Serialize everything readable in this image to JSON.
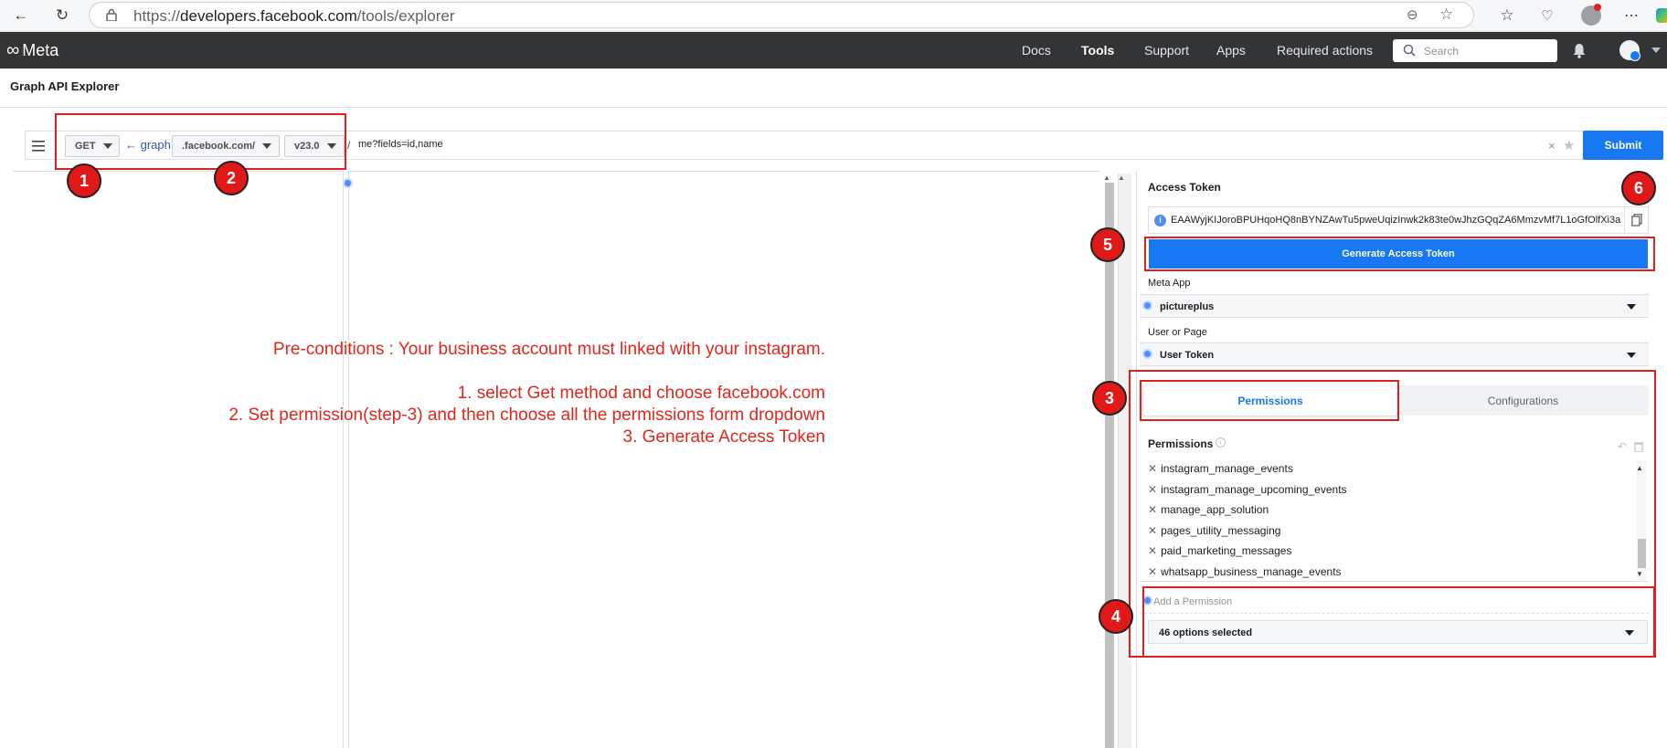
{
  "browser": {
    "url_prefix": "https://",
    "url_host": "developers.facebook.com",
    "url_path": "/tools/explorer"
  },
  "nav": {
    "logo": "Meta",
    "links": [
      "Docs",
      "Tools",
      "Support",
      "Apps",
      "Required actions"
    ],
    "active": "Tools",
    "search_placeholder": "Search"
  },
  "page": {
    "title": "Graph API Explorer"
  },
  "query": {
    "method": "GET",
    "host_prefix": "← graph.",
    "domain": ".facebook.com/",
    "version": "v23.0",
    "slash": "/",
    "path": "me?fields=id,name",
    "submit_label": "Submit"
  },
  "token": {
    "section_label": "Access Token",
    "value": "EAAWyjKIJoroBPUHqoHQ8nBYNZAwTu5pweUqizInwk2k83te0wJhzGQqZA6MmzvMf7L1oGfOlfXi3a",
    "generate_label": "Generate Access Token"
  },
  "meta_app": {
    "label": "Meta App",
    "value": "pictureplus"
  },
  "user_page": {
    "label": "User or Page",
    "value": "User Token"
  },
  "tabs": {
    "permissions": "Permissions",
    "configurations": "Configurations"
  },
  "permissions": {
    "heading": "Permissions",
    "items": [
      "instagram_manage_events",
      "instagram_manage_upcoming_events",
      "manage_app_solution",
      "pages_utility_messaging",
      "paid_marketing_messages",
      "whatsapp_business_manage_events"
    ],
    "add_placeholder": "Add a Permission",
    "selected_summary": "46 options selected"
  },
  "annotations": {
    "line1": "Pre-conditions : Your business account must linked with your instagram.",
    "line2": "1. select Get method and choose facebook.com",
    "line3": "2. Set permission(step-3) and then choose all the permissions form dropdown",
    "line4": "3. Generate Access Token",
    "badges": [
      "1",
      "2",
      "3",
      "4",
      "5",
      "6"
    ]
  },
  "colors": {
    "brand_blue": "#1877f2",
    "annotation_red": "#e0271c",
    "nav_dark": "#333436"
  }
}
